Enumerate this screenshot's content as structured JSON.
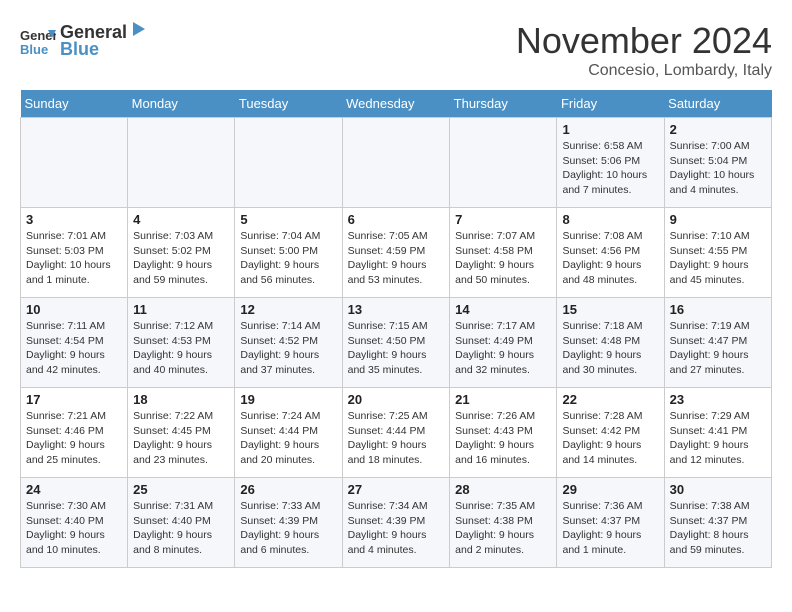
{
  "logo": {
    "line1": "General",
    "line2": "Blue"
  },
  "title": "November 2024",
  "subtitle": "Concesio, Lombardy, Italy",
  "weekdays": [
    "Sunday",
    "Monday",
    "Tuesday",
    "Wednesday",
    "Thursday",
    "Friday",
    "Saturday"
  ],
  "weeks": [
    [
      {
        "day": "",
        "info": ""
      },
      {
        "day": "",
        "info": ""
      },
      {
        "day": "",
        "info": ""
      },
      {
        "day": "",
        "info": ""
      },
      {
        "day": "",
        "info": ""
      },
      {
        "day": "1",
        "info": "Sunrise: 6:58 AM\nSunset: 5:06 PM\nDaylight: 10 hours and 7 minutes."
      },
      {
        "day": "2",
        "info": "Sunrise: 7:00 AM\nSunset: 5:04 PM\nDaylight: 10 hours and 4 minutes."
      }
    ],
    [
      {
        "day": "3",
        "info": "Sunrise: 7:01 AM\nSunset: 5:03 PM\nDaylight: 10 hours and 1 minute."
      },
      {
        "day": "4",
        "info": "Sunrise: 7:03 AM\nSunset: 5:02 PM\nDaylight: 9 hours and 59 minutes."
      },
      {
        "day": "5",
        "info": "Sunrise: 7:04 AM\nSunset: 5:00 PM\nDaylight: 9 hours and 56 minutes."
      },
      {
        "day": "6",
        "info": "Sunrise: 7:05 AM\nSunset: 4:59 PM\nDaylight: 9 hours and 53 minutes."
      },
      {
        "day": "7",
        "info": "Sunrise: 7:07 AM\nSunset: 4:58 PM\nDaylight: 9 hours and 50 minutes."
      },
      {
        "day": "8",
        "info": "Sunrise: 7:08 AM\nSunset: 4:56 PM\nDaylight: 9 hours and 48 minutes."
      },
      {
        "day": "9",
        "info": "Sunrise: 7:10 AM\nSunset: 4:55 PM\nDaylight: 9 hours and 45 minutes."
      }
    ],
    [
      {
        "day": "10",
        "info": "Sunrise: 7:11 AM\nSunset: 4:54 PM\nDaylight: 9 hours and 42 minutes."
      },
      {
        "day": "11",
        "info": "Sunrise: 7:12 AM\nSunset: 4:53 PM\nDaylight: 9 hours and 40 minutes."
      },
      {
        "day": "12",
        "info": "Sunrise: 7:14 AM\nSunset: 4:52 PM\nDaylight: 9 hours and 37 minutes."
      },
      {
        "day": "13",
        "info": "Sunrise: 7:15 AM\nSunset: 4:50 PM\nDaylight: 9 hours and 35 minutes."
      },
      {
        "day": "14",
        "info": "Sunrise: 7:17 AM\nSunset: 4:49 PM\nDaylight: 9 hours and 32 minutes."
      },
      {
        "day": "15",
        "info": "Sunrise: 7:18 AM\nSunset: 4:48 PM\nDaylight: 9 hours and 30 minutes."
      },
      {
        "day": "16",
        "info": "Sunrise: 7:19 AM\nSunset: 4:47 PM\nDaylight: 9 hours and 27 minutes."
      }
    ],
    [
      {
        "day": "17",
        "info": "Sunrise: 7:21 AM\nSunset: 4:46 PM\nDaylight: 9 hours and 25 minutes."
      },
      {
        "day": "18",
        "info": "Sunrise: 7:22 AM\nSunset: 4:45 PM\nDaylight: 9 hours and 23 minutes."
      },
      {
        "day": "19",
        "info": "Sunrise: 7:24 AM\nSunset: 4:44 PM\nDaylight: 9 hours and 20 minutes."
      },
      {
        "day": "20",
        "info": "Sunrise: 7:25 AM\nSunset: 4:44 PM\nDaylight: 9 hours and 18 minutes."
      },
      {
        "day": "21",
        "info": "Sunrise: 7:26 AM\nSunset: 4:43 PM\nDaylight: 9 hours and 16 minutes."
      },
      {
        "day": "22",
        "info": "Sunrise: 7:28 AM\nSunset: 4:42 PM\nDaylight: 9 hours and 14 minutes."
      },
      {
        "day": "23",
        "info": "Sunrise: 7:29 AM\nSunset: 4:41 PM\nDaylight: 9 hours and 12 minutes."
      }
    ],
    [
      {
        "day": "24",
        "info": "Sunrise: 7:30 AM\nSunset: 4:40 PM\nDaylight: 9 hours and 10 minutes."
      },
      {
        "day": "25",
        "info": "Sunrise: 7:31 AM\nSunset: 4:40 PM\nDaylight: 9 hours and 8 minutes."
      },
      {
        "day": "26",
        "info": "Sunrise: 7:33 AM\nSunset: 4:39 PM\nDaylight: 9 hours and 6 minutes."
      },
      {
        "day": "27",
        "info": "Sunrise: 7:34 AM\nSunset: 4:39 PM\nDaylight: 9 hours and 4 minutes."
      },
      {
        "day": "28",
        "info": "Sunrise: 7:35 AM\nSunset: 4:38 PM\nDaylight: 9 hours and 2 minutes."
      },
      {
        "day": "29",
        "info": "Sunrise: 7:36 AM\nSunset: 4:37 PM\nDaylight: 9 hours and 1 minute."
      },
      {
        "day": "30",
        "info": "Sunrise: 7:38 AM\nSunset: 4:37 PM\nDaylight: 8 hours and 59 minutes."
      }
    ]
  ]
}
